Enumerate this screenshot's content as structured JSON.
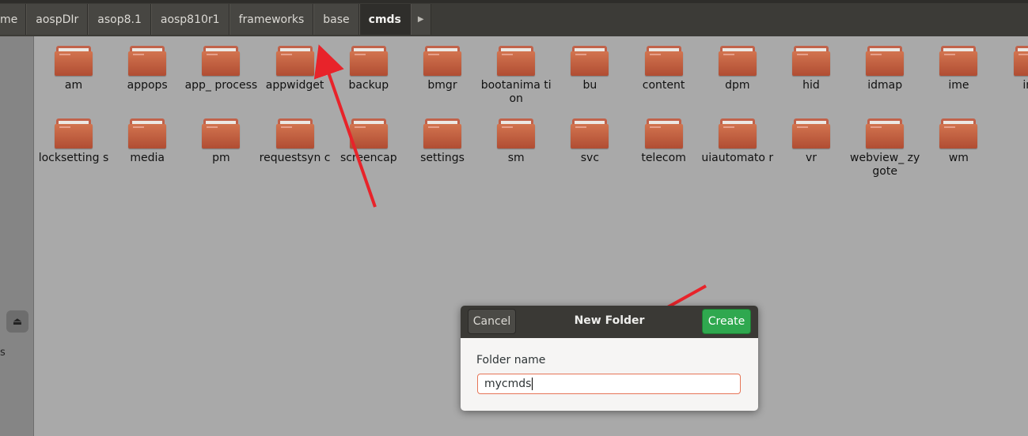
{
  "pathbar": {
    "crumbs": [
      {
        "label": "me"
      },
      {
        "label": "aospDIr"
      },
      {
        "label": "asop8.1"
      },
      {
        "label": "aosp810r1"
      },
      {
        "label": "frameworks"
      },
      {
        "label": "base"
      },
      {
        "label": "cmds"
      }
    ],
    "active": "cmds"
  },
  "sidebar": {
    "fragment": "s",
    "eject_icon": "eject-icon"
  },
  "folders": [
    {
      "name": "am"
    },
    {
      "name": "appops"
    },
    {
      "name": "app_ process"
    },
    {
      "name": "appwidget"
    },
    {
      "name": "backup"
    },
    {
      "name": "bmgr"
    },
    {
      "name": "bootanima tion"
    },
    {
      "name": "bu"
    },
    {
      "name": "content"
    },
    {
      "name": "dpm"
    },
    {
      "name": "hid"
    },
    {
      "name": "idmap"
    },
    {
      "name": "ime"
    },
    {
      "name": "inci"
    },
    {
      "name": "locksetting s"
    },
    {
      "name": "media"
    },
    {
      "name": "pm"
    },
    {
      "name": "requestsyn c"
    },
    {
      "name": "screencap"
    },
    {
      "name": "settings"
    },
    {
      "name": "sm"
    },
    {
      "name": "svc"
    },
    {
      "name": "telecom"
    },
    {
      "name": "uiautomato r"
    },
    {
      "name": "vr"
    },
    {
      "name": "webview_ zygote"
    },
    {
      "name": "wm"
    }
  ],
  "dialog": {
    "title": "New Folder",
    "cancel_label": "Cancel",
    "create_label": "Create",
    "field_label": "Folder name",
    "field_value": "mycmds"
  },
  "colors": {
    "folder": "#c8643f",
    "create": "#2fa84f",
    "arrow": "#e8232a",
    "input_border": "#e67557"
  }
}
